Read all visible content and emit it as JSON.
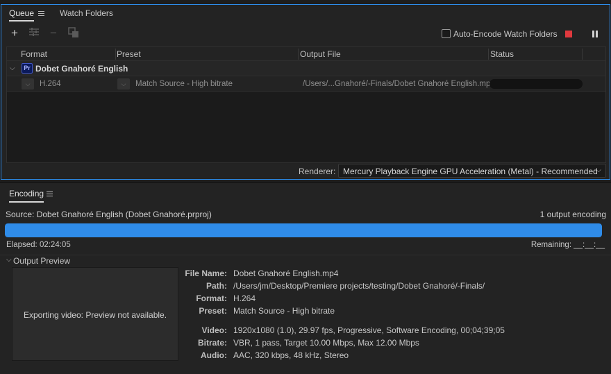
{
  "queue_panel": {
    "tabs": [
      "Queue",
      "Watch Folders"
    ],
    "toolbar": {
      "add_icon": "plus-icon",
      "settings_icon": "settings-sliders-icon",
      "remove_icon": "minus-icon",
      "duplicate_icon": "duplicate-icon",
      "auto_encode_label": "Auto-Encode Watch Folders",
      "auto_encode_checked": false
    },
    "columns": [
      "Format",
      "Preset",
      "Output File",
      "Status"
    ],
    "group": {
      "app_icon": "Pr",
      "name": "Dobet Gnahoré English"
    },
    "item": {
      "format": "H.264",
      "preset": "Match Source - High bitrate",
      "output_file": "/Users/...Gnahoré/-Finals/Dobet Gnahoré English.mp4"
    },
    "renderer_label": "Renderer:",
    "renderer_value": "Mercury Playback Engine GPU Acceleration (Metal) - Recommended"
  },
  "encoding_panel": {
    "tab": "Encoding",
    "source": "Source: Dobet Gnahoré English (Dobet Gnahoré.prproj)",
    "output_count": "1 output encoding",
    "progress_fraction": 1.0,
    "elapsed": "Elapsed: 02:24:05",
    "remaining": "Remaining: __:__:__",
    "preview_header": "Output Preview",
    "preview_message": "Exporting video: Preview not available.",
    "details": [
      {
        "key": "File Name:",
        "value": "Dobet Gnahoré English.mp4"
      },
      {
        "key": "Path:",
        "value": "/Users/jm/Desktop/Premiere projects/testing/Dobet Gnahoré/-Finals/"
      },
      {
        "key": "Format:",
        "value": "H.264"
      },
      {
        "key": "Preset:",
        "value": "Match Source - High bitrate"
      },
      {
        "key": "Video:",
        "value": "1920x1080 (1.0), 29.97 fps, Progressive, Software Encoding, 00;04;39;05"
      },
      {
        "key": "Bitrate:",
        "value": "VBR, 1 pass, Target 10.00 Mbps, Max 12.00 Mbps"
      },
      {
        "key": "Audio:",
        "value": "AAC, 320 kbps, 48 kHz, Stereo"
      }
    ]
  },
  "colors": {
    "accent": "#2f8ce9",
    "stop": "#e0393e",
    "panel_bg": "#232323"
  }
}
